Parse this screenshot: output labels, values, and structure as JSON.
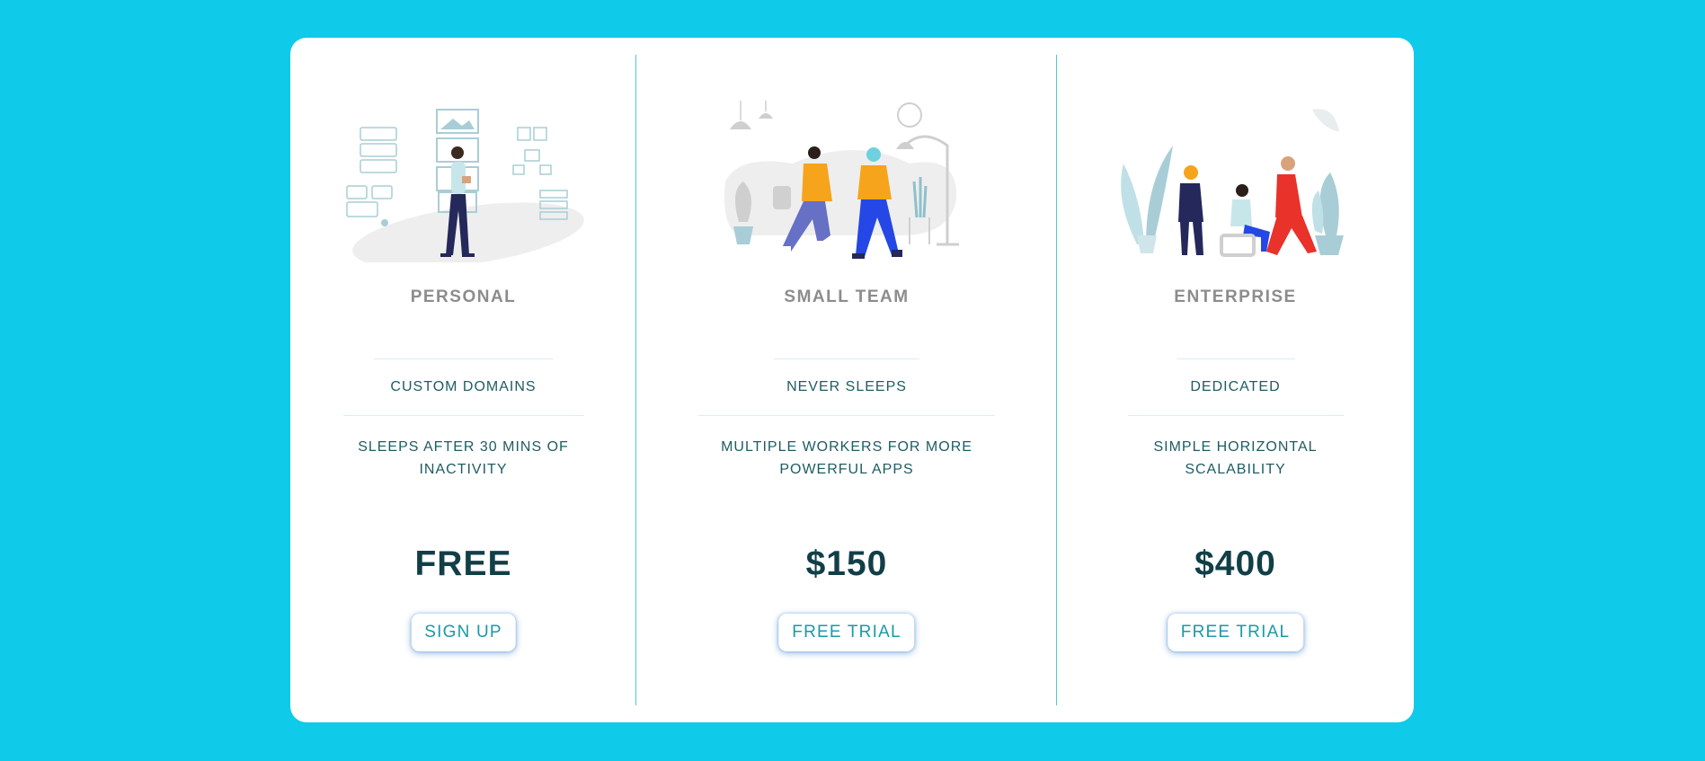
{
  "plans": [
    {
      "name": "PERSONAL",
      "feature_primary": "CUSTOM DOMAINS",
      "feature_secondary": "SLEEPS AFTER 30 MINS OF INACTIVITY",
      "price": "FREE",
      "button_label": "SIGN UP",
      "illustration": "person-browsing-ui-illustration"
    },
    {
      "name": "SMALL TEAM",
      "feature_primary": "NEVER SLEEPS",
      "feature_secondary": "MULTIPLE WORKERS FOR MORE POWERFUL APPS",
      "price": "$150",
      "button_label": "FREE TRIAL",
      "illustration": "two-people-walking-illustration"
    },
    {
      "name": "ENTERPRISE",
      "feature_primary": "DEDICATED",
      "feature_secondary": "SIMPLE HORIZONTAL SCALABILITY",
      "price": "$400",
      "button_label": "FREE TRIAL",
      "illustration": "team-meeting-illustration"
    }
  ],
  "colors": {
    "background": "#0fcae8",
    "card": "#ffffff",
    "divider": "#4fc7cf",
    "plan_name": "#8c8c8c",
    "feature_text": "#1e5c63",
    "price": "#123f47",
    "button_text": "#1a9aa5"
  }
}
